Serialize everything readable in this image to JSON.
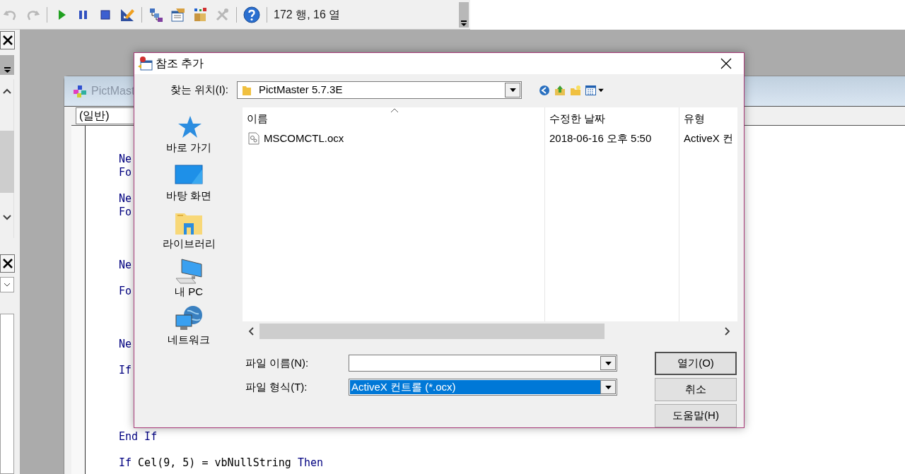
{
  "toolbar": {
    "icons": [
      {
        "kind": "undo",
        "disabled": true
      },
      {
        "kind": "redo",
        "disabled": true
      },
      {
        "kind": "run",
        "disabled": false
      },
      {
        "kind": "pause",
        "disabled": false
      },
      {
        "kind": "stop",
        "disabled": false
      },
      {
        "kind": "design",
        "disabled": false
      },
      {
        "kind": "project",
        "disabled": false
      },
      {
        "kind": "properties",
        "disabled": false
      },
      {
        "kind": "objects",
        "disabled": false
      },
      {
        "kind": "toolbox",
        "disabled": true
      },
      {
        "kind": "help",
        "disabled": false
      }
    ],
    "status": "172 행, 16 열"
  },
  "code_window": {
    "title": "PictMast",
    "object_combo": "(일반)",
    "lines": [
      [
        {
          "text": "Ne",
          "kind": "keyword"
        }
      ],
      [
        {
          "text": "Fo",
          "kind": "keyword"
        }
      ],
      [
        {
          "text": "Ne",
          "kind": "keyword"
        }
      ],
      [
        {
          "text": "Fo",
          "kind": "keyword"
        }
      ],
      [
        {
          "text": "Ne",
          "kind": "keyword"
        }
      ],
      [
        {
          "text": "Fo",
          "kind": "keyword"
        }
      ],
      [
        {
          "text": "Ne",
          "kind": "keyword"
        }
      ],
      [
        {
          "text": "If",
          "kind": "keyword"
        }
      ],
      [
        {
          "text": "End If",
          "kind": "keyword"
        }
      ],
      [
        {
          "text": "If",
          "kind": "keyword"
        },
        {
          "text": "Cel(9, 5) = vbNullString",
          "kind": "plain"
        },
        {
          "text": "Then",
          "kind": "keyword"
        }
      ]
    ]
  },
  "dialog": {
    "title": "참조 추가",
    "look_in": {
      "label": "찾는 위치(I):",
      "value": "PictMaster 5.7.3E"
    },
    "places": [
      {
        "label": "바로 가기",
        "kind": "quick-access"
      },
      {
        "label": "바탕 화면",
        "kind": "desktop"
      },
      {
        "label": "라이브러리",
        "kind": "libraries"
      },
      {
        "label": "내 PC",
        "kind": "this-pc"
      },
      {
        "label": "네트워크",
        "kind": "network"
      }
    ],
    "file_list": {
      "columns": [
        "이름",
        "수정한 날짜",
        "유형"
      ],
      "rows": [
        {
          "name": "MSCOMCTL.ocx",
          "date": "2018-06-16 오후 5:50",
          "type": "ActiveX 컨",
          "selected": false
        }
      ]
    },
    "file_name": {
      "label": "파일 이름(N):"
    },
    "file_type": {
      "label": "파일 형식(T):",
      "value": "ActiveX 컨트롤 (*.ocx)",
      "selected": true
    },
    "buttons": [
      {
        "label": "열기(O)",
        "default": true
      },
      {
        "label": "취소",
        "default": false
      },
      {
        "label": "도움말(H)",
        "default": false
      }
    ]
  }
}
